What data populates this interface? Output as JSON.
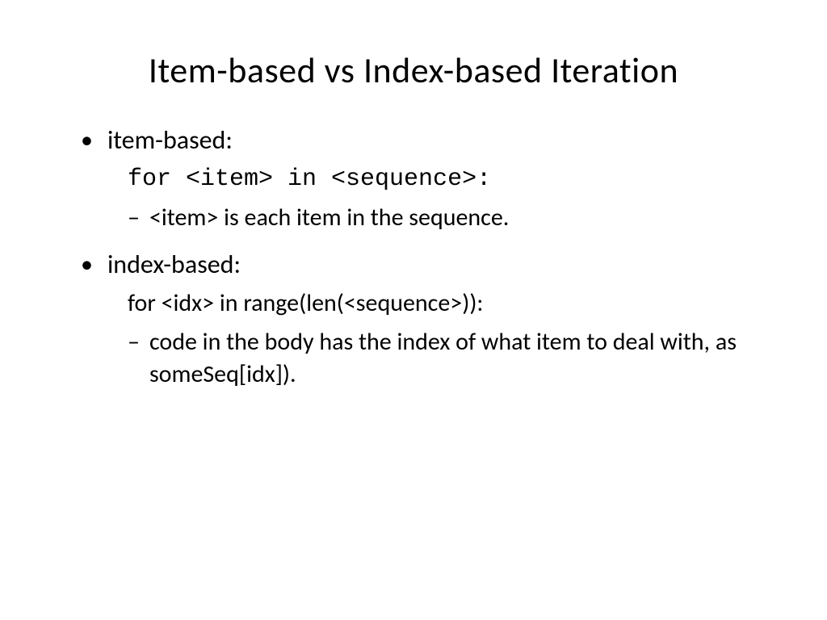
{
  "slide": {
    "title": "Item-based vs Index-based Iteration",
    "bullet1": {
      "label": "item-based:",
      "code": "for <item> in <sequence>:",
      "sub": "<item> is each item in the sequence."
    },
    "bullet2": {
      "label": "index-based:",
      "code": "for <idx> in range(len(<sequence>)):",
      "sub": "code in the body has the index of what item to deal with, as someSeq[idx])."
    }
  }
}
